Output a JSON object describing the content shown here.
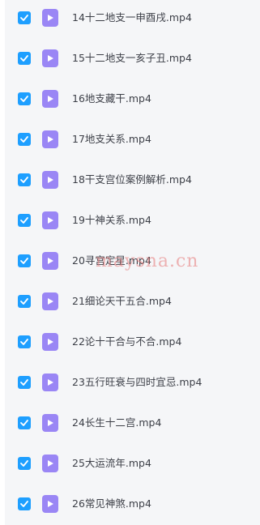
{
  "colors": {
    "checkbox": "#1e9fff",
    "file_icon": "#9a86f5",
    "text": "#3c3f47",
    "panel_background": "#f5f6f8",
    "watermark": "#e67878"
  },
  "icons": {
    "checkbox": "checkmark-icon",
    "file": "video-play-icon"
  },
  "files": [
    {
      "name": "14十二地支一申酉戌.mp4",
      "checked": true
    },
    {
      "name": "15十二地支一亥子丑.mp4",
      "checked": true
    },
    {
      "name": "16地支藏干.mp4",
      "checked": true
    },
    {
      "name": "17地支关系.mp4",
      "checked": true
    },
    {
      "name": "18干支宫位案例解析.mp4",
      "checked": true
    },
    {
      "name": "19十神关系.mp4",
      "checked": true
    },
    {
      "name": "20寻宫定星.mp4",
      "checked": true
    },
    {
      "name": "21细论天干五合.mp4",
      "checked": true
    },
    {
      "name": "22论十干合与不合.mp4",
      "checked": true
    },
    {
      "name": "23五行旺衰与四时宜忌.mp4",
      "checked": true
    },
    {
      "name": "24长生十二宫.mp4",
      "checked": true
    },
    {
      "name": "25大运流年.mp4",
      "checked": true
    },
    {
      "name": "26常见神煞.mp4",
      "checked": true
    }
  ],
  "watermark": "maysna.cn"
}
